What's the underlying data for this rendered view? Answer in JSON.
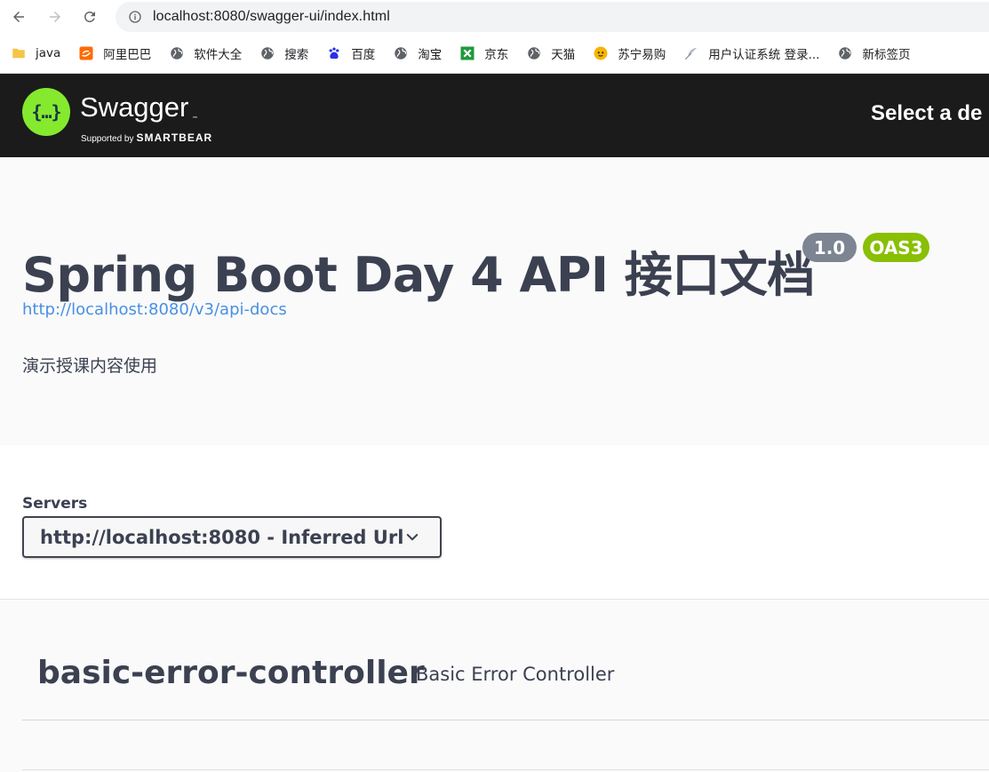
{
  "browser": {
    "url": "localhost:8080/swagger-ui/index.html",
    "bookmarks": [
      {
        "label": "java",
        "icon": "folder-icon"
      },
      {
        "label": "阿里巴巴",
        "icon": "alibaba-icon"
      },
      {
        "label": "软件大全",
        "icon": "globe-icon"
      },
      {
        "label": "搜索",
        "icon": "globe-icon"
      },
      {
        "label": "百度",
        "icon": "baidu-icon"
      },
      {
        "label": "淘宝",
        "icon": "globe-icon"
      },
      {
        "label": "京东",
        "icon": "jd-icon"
      },
      {
        "label": "天猫",
        "icon": "globe-icon"
      },
      {
        "label": "苏宁易购",
        "icon": "suning-icon"
      },
      {
        "label": "用户认证系统 登录...",
        "icon": "feather-icon"
      },
      {
        "label": "新标签页",
        "icon": "globe-icon"
      }
    ]
  },
  "topbar": {
    "logo_glyph": "{…}",
    "brand": "Swagger",
    "tm": "™",
    "supported_by": "Supported by",
    "company": "SMARTBEAR",
    "select_definition": "Select a de"
  },
  "info": {
    "title": "Spring Boot Day 4 API 接口文档",
    "version": "1.0",
    "oas": "OAS3",
    "docs_url": "http://localhost:8080/v3/api-docs",
    "description": "演示授课内容使用"
  },
  "servers": {
    "label": "Servers",
    "selected": "http://localhost:8080 - Inferred Url"
  },
  "tag": {
    "name": "basic-error-controller",
    "description": "Basic Error Controller"
  },
  "colors": {
    "swagger_green": "#85ea2d",
    "topbar_bg": "#1b1b1b",
    "version_badge": "#7d8492",
    "oas_badge": "#89bf04",
    "link": "#4990e2",
    "text": "#3b4151"
  }
}
